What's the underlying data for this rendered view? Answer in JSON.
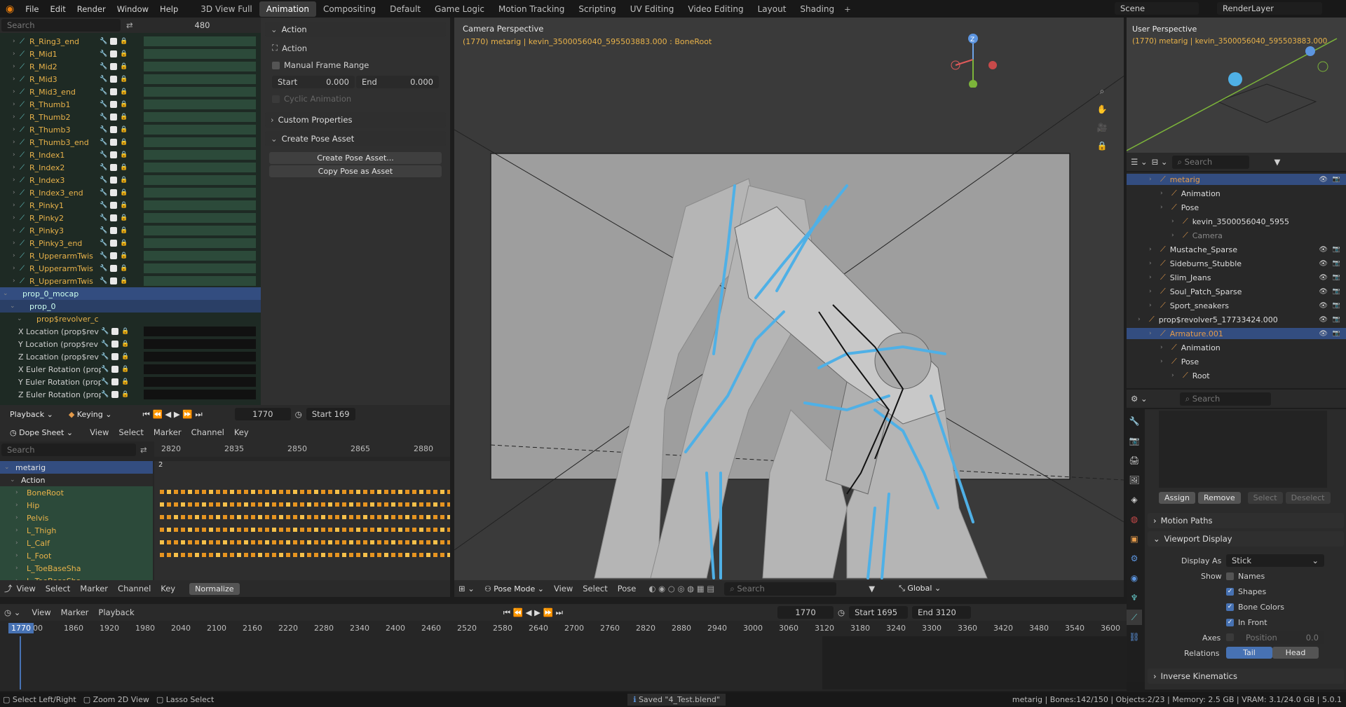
{
  "menus": [
    "File",
    "Edit",
    "Render",
    "Window",
    "Help"
  ],
  "workspaces": [
    "3D View Full",
    "Animation",
    "Compositing",
    "Default",
    "Game Logic",
    "Motion Tracking",
    "Scripting",
    "UV Editing",
    "Video Editing",
    "Layout",
    "Shading"
  ],
  "active_workspace": "Animation",
  "scene": "Scene",
  "render_layer": "RenderLayer",
  "nla": {
    "search_placeholder": "Search",
    "frame": "480",
    "rows": [
      "R_Ring3_end",
      "R_Mid1",
      "R_Mid2",
      "R_Mid3",
      "R_Mid3_end",
      "R_Thumb1",
      "R_Thumb2",
      "R_Thumb3",
      "R_Thumb3_end",
      "R_Index1",
      "R_Index2",
      "R_Index3",
      "R_Index3_end",
      "R_Pinky1",
      "R_Pinky2",
      "R_Pinky3",
      "R_Pinky3_end",
      "R_UpperarmTwis",
      "R_UpperarmTwis",
      "R_UpperarmTwis"
    ],
    "group": "prop_0_mocap",
    "subgroup": "prop_0",
    "object": "prop$revolver_c",
    "channels": [
      "X Location (prop$rev",
      "Y Location (prop$rev",
      "Z Location (prop$rev",
      "X Euler Rotation (prop",
      "Y Euler Rotation (prop",
      "Z Euler Rotation (prop"
    ]
  },
  "action_panel": {
    "header": "Action",
    "action_label": "Action",
    "manual_range": "Manual Frame Range",
    "start_label": "Start",
    "start_val": "0.000",
    "end_label": "End",
    "end_val": "0.000",
    "cyclic": "Cyclic Animation",
    "custom_props": "Custom Properties",
    "create_pose": "Create Pose Asset",
    "create_btn": "Create Pose Asset...",
    "copy_btn": "Copy Pose as Asset"
  },
  "playback_bar": {
    "playback": "Playback",
    "keying": "Keying",
    "frame": "1770",
    "start": "Start",
    "start_val": "169"
  },
  "dope": {
    "mode": "Dope Sheet",
    "menus": [
      "View",
      "Select",
      "Marker",
      "Channel",
      "Key"
    ],
    "search_placeholder": "Search",
    "ticks": [
      "2820",
      "2835",
      "2850",
      "2865",
      "2880"
    ],
    "marker": "2",
    "rows": [
      "metarig",
      "Action",
      "BoneRoot",
      "Hip",
      "Pelvis",
      "L_Thigh",
      "L_Calf",
      "L_Foot",
      "L_ToeBaseSha",
      "L_ToeBaseSha"
    ],
    "footer_menus": [
      "View",
      "Select",
      "Marker",
      "Channel",
      "Key"
    ],
    "normalize": "Normalize"
  },
  "viewport": {
    "title": "Camera Perspective",
    "subtitle": "(1770) metarig | kevin_3500056040_595503883.000 : BoneRoot",
    "mode": "Pose Mode",
    "menus": [
      "View",
      "Select",
      "Pose"
    ],
    "search_placeholder": "Search",
    "orientation": "Global"
  },
  "mini_view": {
    "title": "User Perspective",
    "subtitle": "(1770) metarig | kevin_3500056040_595503883.000"
  },
  "outliner": {
    "search_placeholder": "Search",
    "rows": [
      {
        "t": "metarig",
        "lvl": 2,
        "c": "#e39a4a",
        "sel": true
      },
      {
        "t": "Animation",
        "lvl": 3
      },
      {
        "t": "Pose",
        "lvl": 3
      },
      {
        "t": "kevin_3500056040_5955",
        "lvl": 4
      },
      {
        "t": "Camera",
        "lvl": 4,
        "c": "#888"
      },
      {
        "t": "Mustache_Sparse",
        "lvl": 2
      },
      {
        "t": "Sideburns_Stubble",
        "lvl": 2
      },
      {
        "t": "Slim_Jeans",
        "lvl": 2
      },
      {
        "t": "Soul_Patch_Sparse",
        "lvl": 2
      },
      {
        "t": "Sport_sneakers",
        "lvl": 2
      },
      {
        "t": "prop$revolver5_17733424.000",
        "lvl": 1
      },
      {
        "t": "Armature.001",
        "lvl": 2,
        "c": "#e39a4a",
        "sel": true
      },
      {
        "t": "Animation",
        "lvl": 3
      },
      {
        "t": "Pose",
        "lvl": 3
      },
      {
        "t": "Root",
        "lvl": 4
      }
    ]
  },
  "properties": {
    "search_placeholder": "Search",
    "assign": "Assign",
    "remove": "Remove",
    "select": "Select",
    "deselect": "Deselect",
    "motion_paths": "Motion Paths",
    "viewport_display": "Viewport Display",
    "display_as_label": "Display As",
    "display_as": "Stick",
    "show_label": "Show",
    "names": "Names",
    "shapes": "Shapes",
    "bone_colors": "Bone Colors",
    "in_front": "In Front",
    "axes_label": "Axes",
    "position_label": "Position",
    "position_val": "0.0",
    "relations_label": "Relations",
    "tail": "Tail",
    "head": "Head",
    "ik": "Inverse Kinematics"
  },
  "timeline": {
    "menus": [
      "View",
      "Marker",
      "Playback"
    ],
    "frame": "1770",
    "start_label": "Start",
    "start": "1695",
    "end_label": "End",
    "end": "3120",
    "current": "1770",
    "ticks": [
      "800",
      "1860",
      "1920",
      "1980",
      "2040",
      "2100",
      "2160",
      "2220",
      "2280",
      "2340",
      "2400",
      "2460",
      "2520",
      "2580",
      "2640",
      "2700",
      "2760",
      "2820",
      "2880",
      "2940",
      "3000",
      "3060",
      "3120",
      "3180",
      "3240",
      "3300",
      "3360",
      "3420",
      "3480",
      "3540",
      "3600"
    ]
  },
  "status": {
    "left1": "Select Left/Right",
    "left2": "Zoom 2D View",
    "left3": "Lasso Select",
    "message": "Saved \"4_Test.blend\"",
    "right": "metarig | Bones:142/150 | Objects:2/23 | Memory: 2.5 GB | VRAM: 3.1/24.0 GB | 5.0.1"
  },
  "colors": {
    "accent": "#4772b3",
    "selected_row": "#334d80",
    "bone": "#4fb0e6",
    "keyframe": "#e69420",
    "nla_row": "#2c4a3a"
  }
}
